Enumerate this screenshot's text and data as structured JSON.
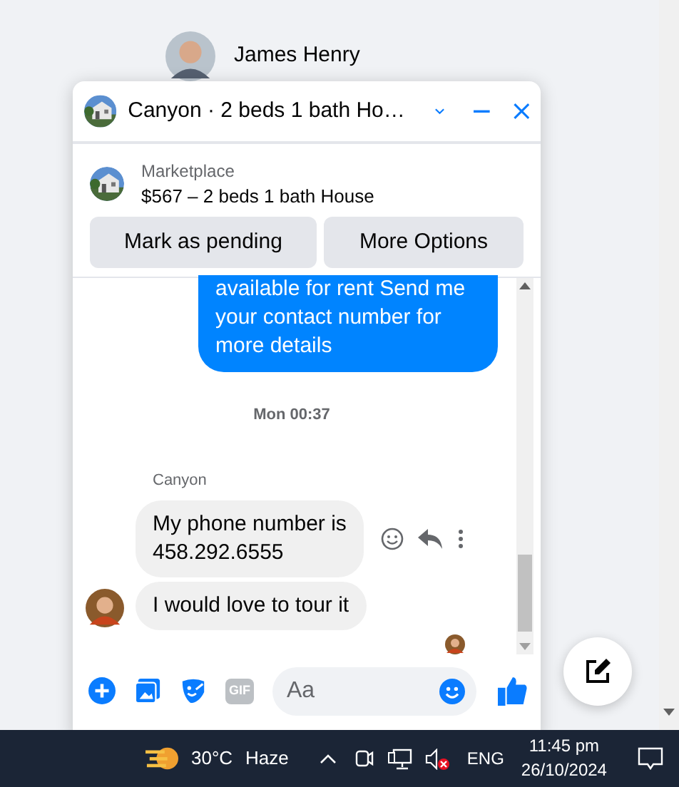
{
  "contact": {
    "name": "James Henry"
  },
  "chat": {
    "title": "Canyon · 2 beds 1 bath Ho…",
    "listing": {
      "source": "Marketplace",
      "summary": "$567 – 2 beds 1 bath House"
    },
    "actions": [
      "Mark as pending",
      "More Options"
    ],
    "messages": [
      {
        "kind": "outgoing",
        "lines": [
          "available for rent Send me",
          "your contact number for",
          "more details"
        ]
      },
      {
        "kind": "timestamp",
        "text": "Mon 00:37"
      },
      {
        "kind": "sender",
        "text": "Canyon"
      },
      {
        "kind": "incoming",
        "lines": [
          "My phone number is",
          "458.292.6555"
        ],
        "hovered": true
      },
      {
        "kind": "incoming",
        "lines": [
          "I would love to tour it"
        ],
        "avatar": true
      }
    ],
    "composer": {
      "placeholder": "Aa",
      "gif": "GIF"
    }
  },
  "taskbar": {
    "temperature": "30°C",
    "weather": "Haze",
    "language": "ENG",
    "time": "11:45 pm",
    "date": "26/10/2024",
    "muted": true
  }
}
